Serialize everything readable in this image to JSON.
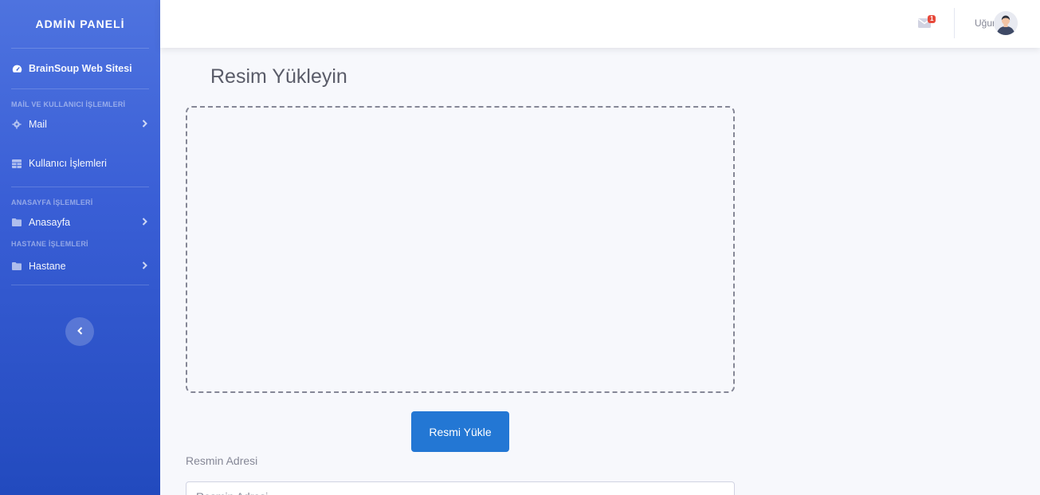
{
  "sidebar": {
    "brand": "ADMİN PANELİ",
    "site_link": {
      "label": "BrainSoup Web Sitesi",
      "icon": "tachometer-icon"
    },
    "sections": [
      {
        "heading": "MAİL VE KULLANICI İŞLEMLERİ"
      },
      {
        "heading": "ANASAYFA İŞLEMLERİ"
      },
      {
        "heading": "HASTANE İŞLEMLERİ"
      }
    ],
    "items": [
      {
        "label": "Mail",
        "icon": "gear-icon",
        "expandable": true
      },
      {
        "label": "Kullanıcı İşlemleri",
        "icon": "table-icon",
        "expandable": false
      },
      {
        "label": "Anasayfa",
        "icon": "folder-icon",
        "expandable": true
      },
      {
        "label": "Hastane",
        "icon": "folder-icon",
        "expandable": true
      }
    ],
    "toggle_icon": "chevron-left-icon"
  },
  "topbar": {
    "mail_count": "1",
    "user_name": "Uğur"
  },
  "main": {
    "title": "Resim Yükleyin",
    "upload_button": "Resmi Yükle",
    "address_label": "Resmin Adresi",
    "address_placeholder": "Resmin Adresi"
  },
  "colors": {
    "sidebar_top": "#4e73df",
    "sidebar_bottom": "#224abe",
    "button": "#2377d4",
    "badge": "#e74a3b"
  }
}
